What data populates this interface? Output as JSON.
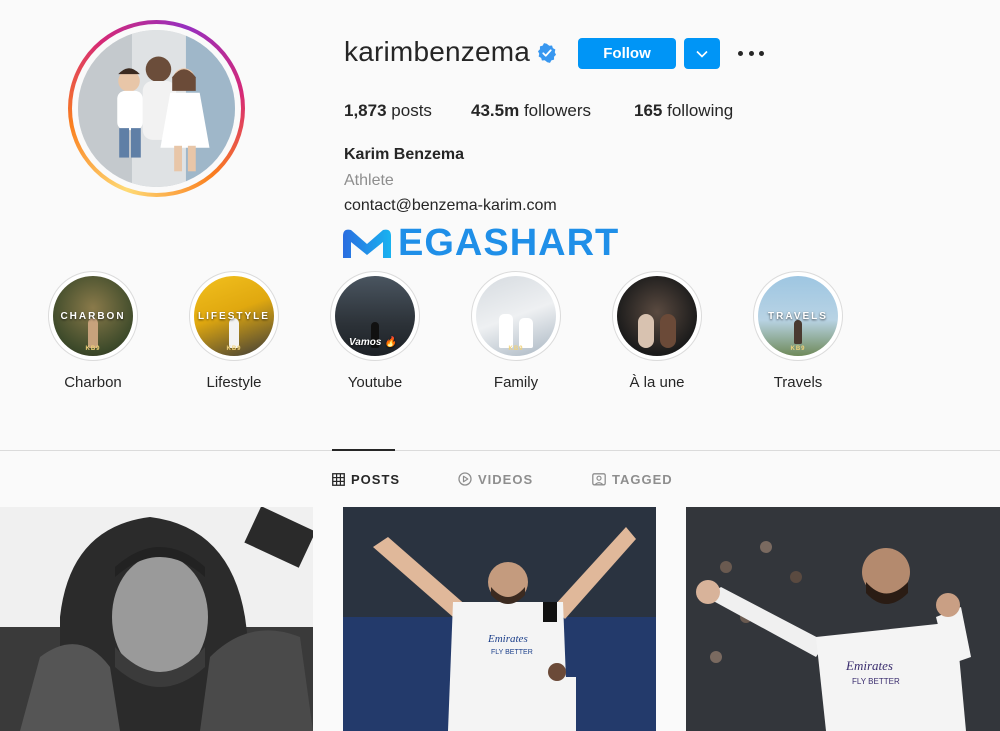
{
  "profile": {
    "username": "karimbenzema",
    "follow_label": "Follow",
    "posts_count": "1,873",
    "posts_label": "posts",
    "followers_count": "43.5m",
    "followers_label": "followers",
    "following_count": "165",
    "following_label": "following",
    "full_name": "Karim Benzema",
    "category": "Athlete",
    "contact": "contact@benzema-karim.com"
  },
  "watermark": {
    "text": "EGASHART"
  },
  "highlights": [
    {
      "label": "Charbon",
      "caption": "CHARBON",
      "badge": "KB9"
    },
    {
      "label": "Lifestyle",
      "caption": "LIFESTYLE",
      "badge": "KB9"
    },
    {
      "label": "Youtube",
      "caption": "Vamos 🔥",
      "badge": ""
    },
    {
      "label": "Family",
      "caption": "",
      "badge": "KB9"
    },
    {
      "label": "À la une",
      "caption": "",
      "badge": ""
    },
    {
      "label": "Travels",
      "caption": "TRAVELS",
      "badge": "KB9"
    }
  ],
  "tabs": [
    {
      "label": "POSTS",
      "icon": "grid-icon",
      "active": true
    },
    {
      "label": "VIDEOS",
      "icon": "play-icon",
      "active": false
    },
    {
      "label": "TAGGED",
      "icon": "tag-icon",
      "active": false
    }
  ],
  "posts": [
    {
      "jersey_text": ""
    },
    {
      "jersey_text": "Emirates FLY BETTER"
    },
    {
      "jersey_text": "Emirates FLY BETTER"
    }
  ],
  "colors": {
    "accent": "#0095f6",
    "text": "#262626",
    "muted": "#8e8e8e",
    "verified": "#3897f0"
  }
}
